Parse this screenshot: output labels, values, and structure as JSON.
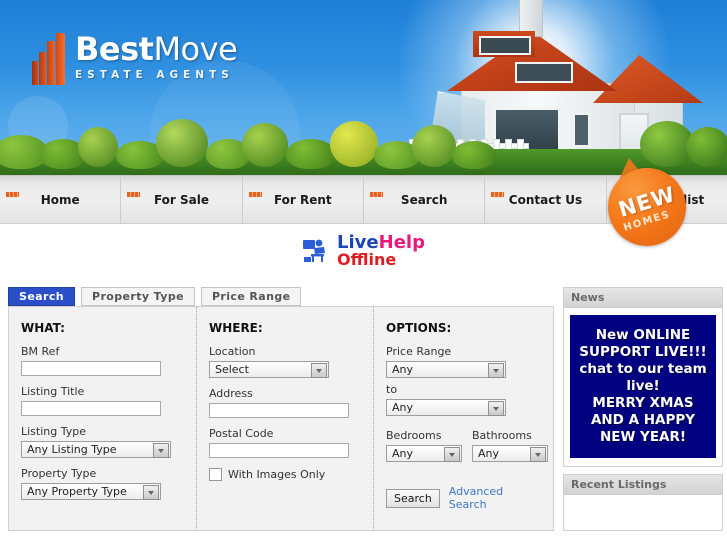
{
  "site": {
    "logo_name_bold": "Best",
    "logo_name_light": "Move",
    "logo_tagline": "ESTATE AGENTS"
  },
  "banner": {
    "badge_line1": "NEW",
    "badge_line2": "HOMES"
  },
  "nav": {
    "items": [
      {
        "label": "Home"
      },
      {
        "label": "For Sale"
      },
      {
        "label": "For Rent"
      },
      {
        "label": "Search"
      },
      {
        "label": "Contact Us"
      },
      {
        "label": "Mailing list"
      }
    ]
  },
  "live_help": {
    "title_part1": "Live",
    "title_part2": "Help",
    "status": "Offline"
  },
  "tabs": [
    {
      "label": "Search",
      "active": true
    },
    {
      "label": "Property Type",
      "active": false
    },
    {
      "label": "Price Range",
      "active": false
    }
  ],
  "search_form": {
    "what": {
      "heading": "WHAT:",
      "bm_ref_label": "BM Ref",
      "bm_ref_value": "",
      "listing_title_label": "Listing Title",
      "listing_title_value": "",
      "listing_type_label": "Listing Type",
      "listing_type_value": "Any Listing Type",
      "property_type_label": "Property Type",
      "property_type_value": "Any Property Type"
    },
    "where": {
      "heading": "WHERE:",
      "location_label": "Location",
      "location_value": "Select",
      "address_label": "Address",
      "address_value": "",
      "postal_code_label": "Postal Code",
      "postal_code_value": "",
      "with_images_label": "With Images Only",
      "with_images_checked": false
    },
    "options": {
      "heading": "OPTIONS:",
      "price_range_label": "Price Range",
      "price_min_value": "Any",
      "to_label": "to",
      "price_max_value": "Any",
      "bedrooms_label": "Bedrooms",
      "bedrooms_value": "Any",
      "bathrooms_label": "Bathrooms",
      "bathrooms_value": "Any",
      "search_button": "Search",
      "advanced_link": "Advanced Search"
    }
  },
  "sidebar": {
    "news": {
      "heading": "News",
      "lines": [
        "New ONLINE",
        "SUPPORT LIVE!!!",
        "chat to our team",
        "live!",
        "MERRY XMAS",
        "AND A HAPPY",
        "NEW YEAR!"
      ]
    },
    "recent": {
      "heading": "Recent Listings"
    }
  },
  "colors": {
    "accent_blue": "#2b4fc8",
    "news_navy": "#000080",
    "badge_orange": "#f5781b",
    "link_blue": "#3b78c3"
  }
}
